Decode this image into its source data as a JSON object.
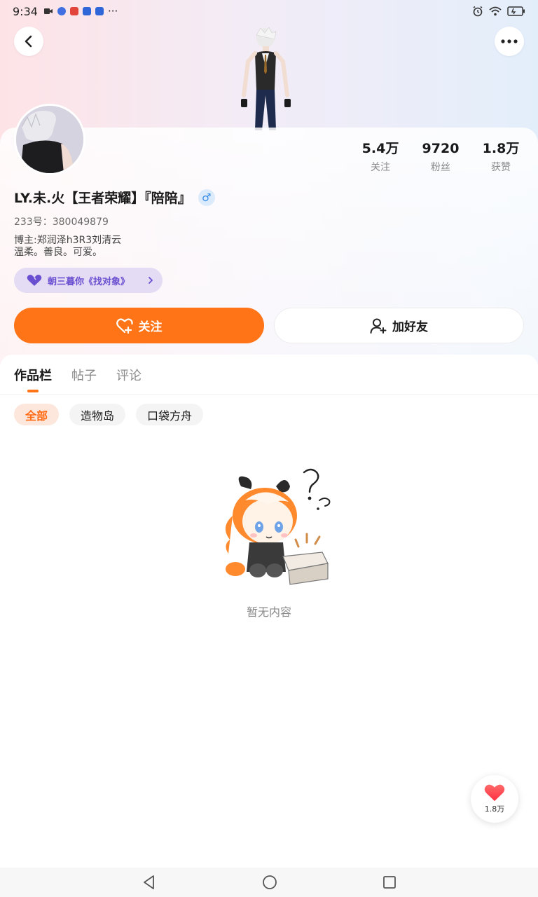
{
  "status_bar": {
    "time": "9:34",
    "overflow": "···",
    "icons": [
      "video-icon",
      "app-icon",
      "app-icon",
      "paw-icon",
      "paw-icon"
    ],
    "right_icons": [
      "alarm-icon",
      "wifi-icon",
      "battery-icon"
    ]
  },
  "header": {
    "back_icon": "chevron-left-icon",
    "more_icon": "more-horizontal-icon"
  },
  "profile": {
    "stats": [
      {
        "value": "5.4万",
        "label": "关注"
      },
      {
        "value": "9720",
        "label": "粉丝"
      },
      {
        "value": "1.8万",
        "label": "获赞"
      }
    ],
    "name": "LY.未.火【王者荣耀】『陪陪』",
    "gender_symbol": "♂",
    "uid": "233号：380049879",
    "bio_lines": [
      "博主:郑润泽h3R3刘清云",
      "温柔。善良。可爱。"
    ],
    "tag": "朝三暮你《找对象》"
  },
  "actions": {
    "follow_label": "关注",
    "add_friend_label": "加好友"
  },
  "tabs": [
    {
      "label": "作品栏",
      "active": true
    },
    {
      "label": "帖子",
      "active": false
    },
    {
      "label": "评论",
      "active": false
    }
  ],
  "filters": [
    {
      "label": "全部",
      "active": true
    },
    {
      "label": "造物岛",
      "active": false
    },
    {
      "label": "口袋方舟",
      "active": false
    }
  ],
  "empty_state": {
    "text": "暂无内容"
  },
  "like_button": {
    "count": "1.8万"
  },
  "colors": {
    "accent": "#ff7417",
    "tag_purple": "#6a4fd0",
    "gender_blue": "#3a8de8"
  }
}
